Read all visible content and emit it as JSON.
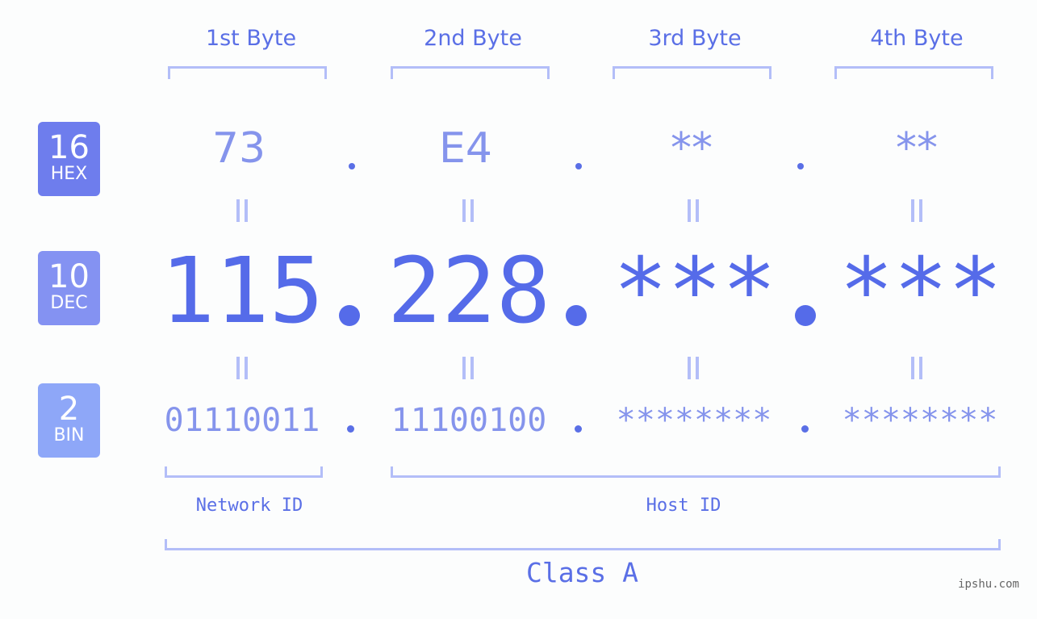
{
  "colors": {
    "accent": "#5a6fe6",
    "accent_light": "#8594ec",
    "bracket": "#b3bef8",
    "hex_badge": "#6e7ded",
    "dec_badge": "#8492f2",
    "bin_badge": "#8ea7f8",
    "background": "#fcfdfd"
  },
  "byte_headers": [
    "1st Byte",
    "2nd Byte",
    "3rd Byte",
    "4th Byte"
  ],
  "badges": {
    "hex": {
      "number": "16",
      "label": "HEX"
    },
    "dec": {
      "number": "10",
      "label": "DEC"
    },
    "bin": {
      "number": "2",
      "label": "BIN"
    }
  },
  "hex": [
    "73",
    "E4",
    "**",
    "**"
  ],
  "dec": [
    "115",
    "228",
    "***",
    "***"
  ],
  "bin": [
    "01110011",
    "11100100",
    "********",
    "********"
  ],
  "labels": {
    "network_id": "Network ID",
    "host_id": "Host ID",
    "ip_class": "Class A"
  },
  "watermark": "ipshu.com"
}
